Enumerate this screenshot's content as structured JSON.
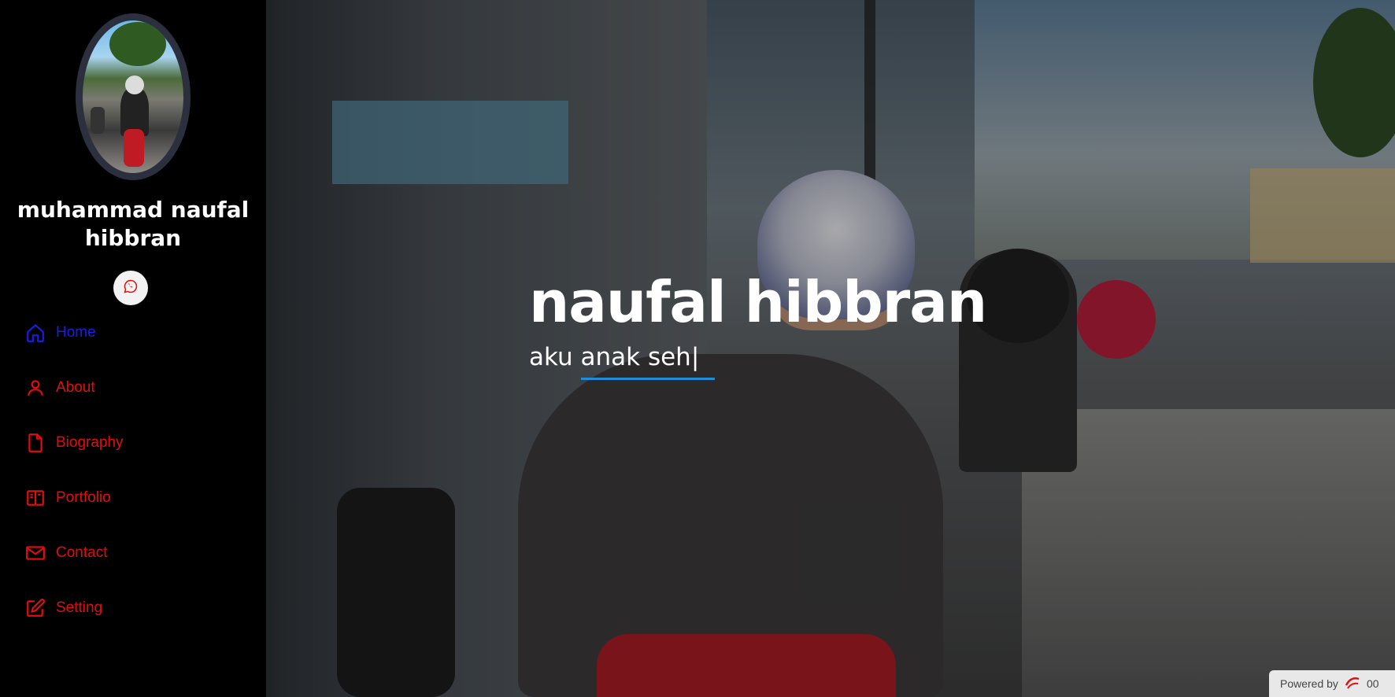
{
  "profile": {
    "name": "muhammad naufal hibbran",
    "avatar_icon": "profile-photo",
    "social_icon": "whatsapp-icon"
  },
  "nav": {
    "items": [
      {
        "label": "Home",
        "icon": "home-icon",
        "active": true
      },
      {
        "label": "About",
        "icon": "person-icon",
        "active": false
      },
      {
        "label": "Biography",
        "icon": "file-icon",
        "active": false
      },
      {
        "label": "Portfolio",
        "icon": "book-icon",
        "active": false
      },
      {
        "label": "Contact",
        "icon": "envelope-icon",
        "active": false
      },
      {
        "label": "Setting",
        "icon": "pencil-square-icon",
        "active": false
      }
    ]
  },
  "hero": {
    "title": "naufal hibbran",
    "subtitle": "aku anak seh",
    "cursor": "|"
  },
  "badge": {
    "label": "Powered by",
    "suffix": "00"
  },
  "colors": {
    "nav_text": "#e30d0d",
    "nav_active": "#1c1ce8",
    "underline": "#1f8ddc",
    "sidebar_bg": "#000000"
  }
}
